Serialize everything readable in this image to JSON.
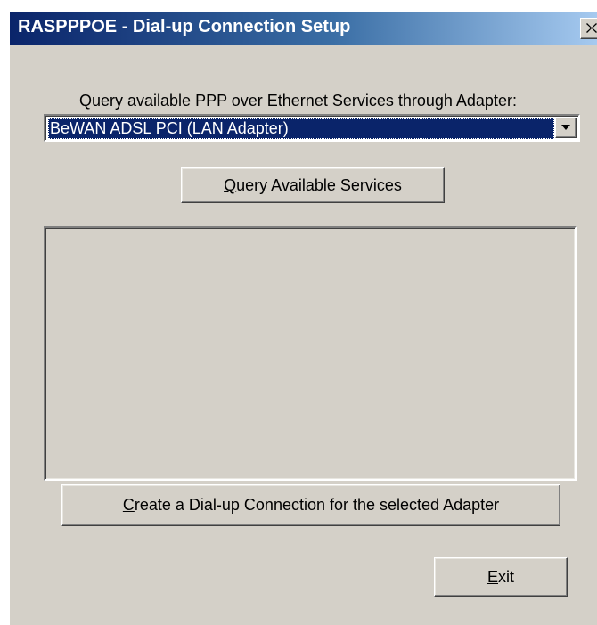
{
  "window": {
    "title": "RASPPPOE - Dial-up Connection Setup",
    "close_icon": "close-x-icon"
  },
  "adapter": {
    "label": "Query available PPP over Ethernet Services through Adapter:",
    "selected": "BeWAN ADSL PCI (LAN Adapter)",
    "dropdown_icon": "chevron-down-icon"
  },
  "buttons": {
    "query_mnemonic": "Q",
    "query_rest": "uery Available Services",
    "create_mnemonic": "C",
    "create_rest": "reate a Dial-up Connection for the selected Adapter",
    "exit_mnemonic": "E",
    "exit_rest": "xit"
  },
  "services": {
    "items": []
  },
  "colors": {
    "face": "#d4d0c8",
    "title_active": "#0a246a",
    "selection": "#0a246a"
  }
}
